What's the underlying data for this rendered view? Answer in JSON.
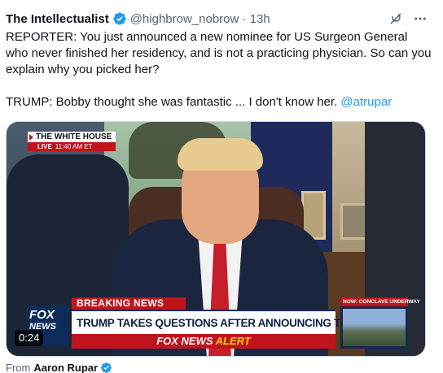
{
  "tweet": {
    "display_name": "The Intellectualist",
    "handle": "@highbrow_nobrow",
    "time_separator": "·",
    "time": "13h",
    "text_line1": "REPORTER: You just announced a new nominee for US Surgeon General who never finished her residency, and is not a practicing physician. So can you explain why you picked her?",
    "text_line2": "TRUMP: Bobby thought she was fantastic ... I don't know her.",
    "mention": "@atrupar"
  },
  "media": {
    "duration": "0:24",
    "chyron": {
      "location_title": "THE WHITE HOUSE",
      "live_label": "LIVE",
      "live_time": "11:40 AM ET",
      "breaking_label": "BREAKING NEWS",
      "headline": "TRUMP TAKES QUESTIONS AFTER ANNOUNCING TRADE DEAL",
      "alert_prefix": "FOX NEWS ",
      "alert_word": "ALERT",
      "side_box_label": "NOW: CONCLAVE UNDERWAY",
      "logo_main": "FOX",
      "logo_sub": "NEWS"
    }
  },
  "attribution": {
    "prefix": "From",
    "author": "Aaron Rupar"
  },
  "icons": {
    "verified": "verified-badge-icon",
    "grok": "grok-icon",
    "more": "more-icon"
  },
  "colors": {
    "accent": "#1d9bf0",
    "secondary_text": "#536471",
    "fox_red": "#c0141c",
    "fox_navy": "#0e2c5a"
  }
}
